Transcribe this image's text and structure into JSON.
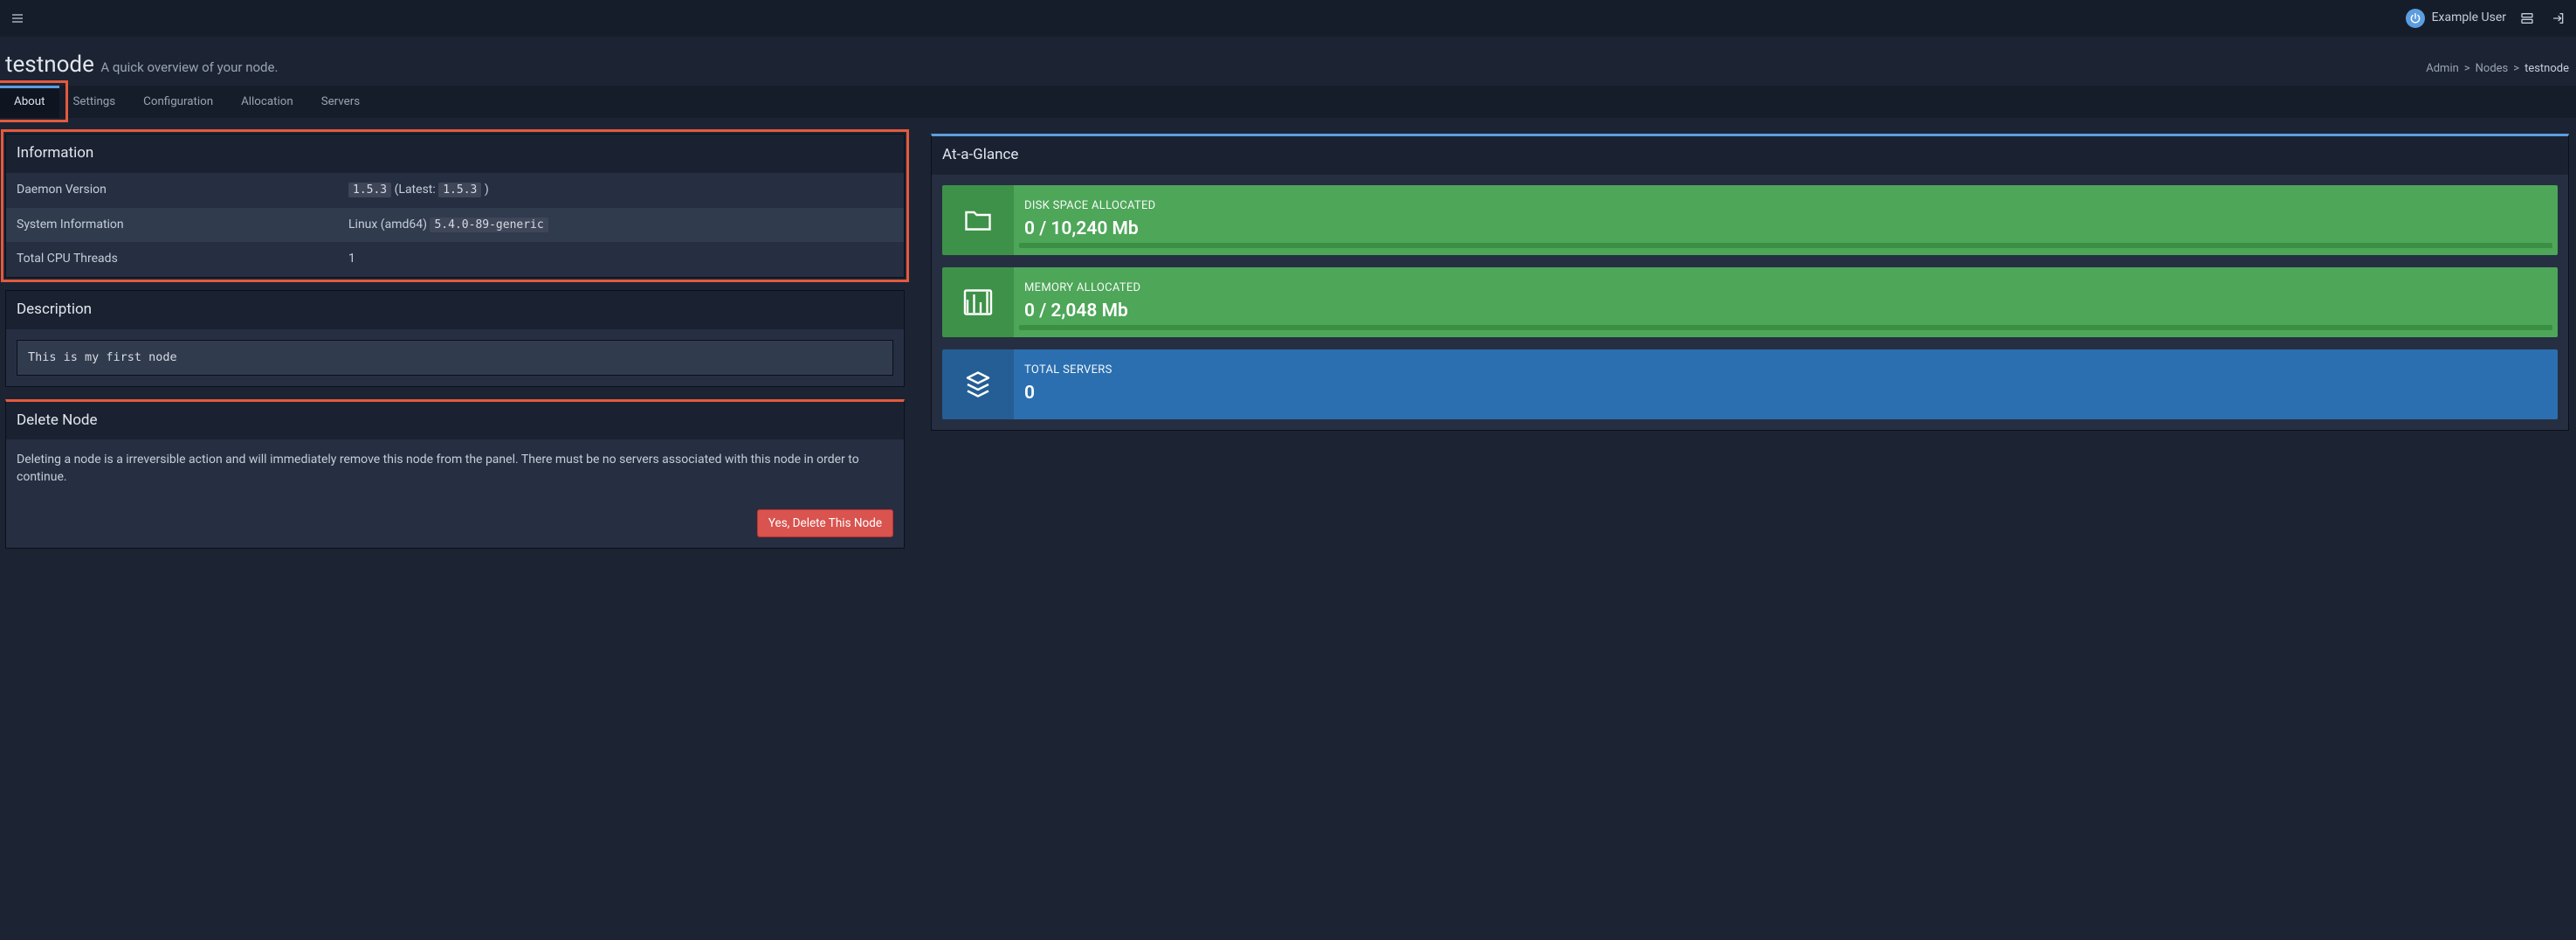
{
  "user": {
    "name": "Example User"
  },
  "header": {
    "title": "testnode",
    "subtitle": "A quick overview of your node."
  },
  "breadcrumb": {
    "admin": "Admin",
    "nodes": "Nodes",
    "current": "testnode"
  },
  "tabs": {
    "about": "About",
    "settings": "Settings",
    "configuration": "Configuration",
    "allocation": "Allocation",
    "servers": "Servers"
  },
  "info_box": {
    "title": "Information",
    "rows": {
      "daemon_label": "Daemon Version",
      "daemon_version": "1.5.3",
      "daemon_latest_prefix": " (Latest: ",
      "daemon_latest": "1.5.3",
      "daemon_latest_suffix": " )",
      "system_label": "System Information",
      "system_os": "Linux (amd64) ",
      "system_kernel": "5.4.0-89-generic",
      "cpu_label": "Total CPU Threads",
      "cpu_value": "1"
    }
  },
  "description_box": {
    "title": "Description",
    "value": "This is my first node"
  },
  "delete_box": {
    "title": "Delete Node",
    "warning": "Deleting a node is a irreversible action and will immediately remove this node from the panel. There must be no servers associated with this node in order to continue.",
    "button": "Yes, Delete This Node"
  },
  "glance": {
    "title": "At-a-Glance",
    "disk_label": "DISK SPACE ALLOCATED",
    "disk_value": "0 / 10,240 Mb",
    "mem_label": "MEMORY ALLOCATED",
    "mem_value": "0 / 2,048 Mb",
    "servers_label": "TOTAL SERVERS",
    "servers_value": "0"
  }
}
